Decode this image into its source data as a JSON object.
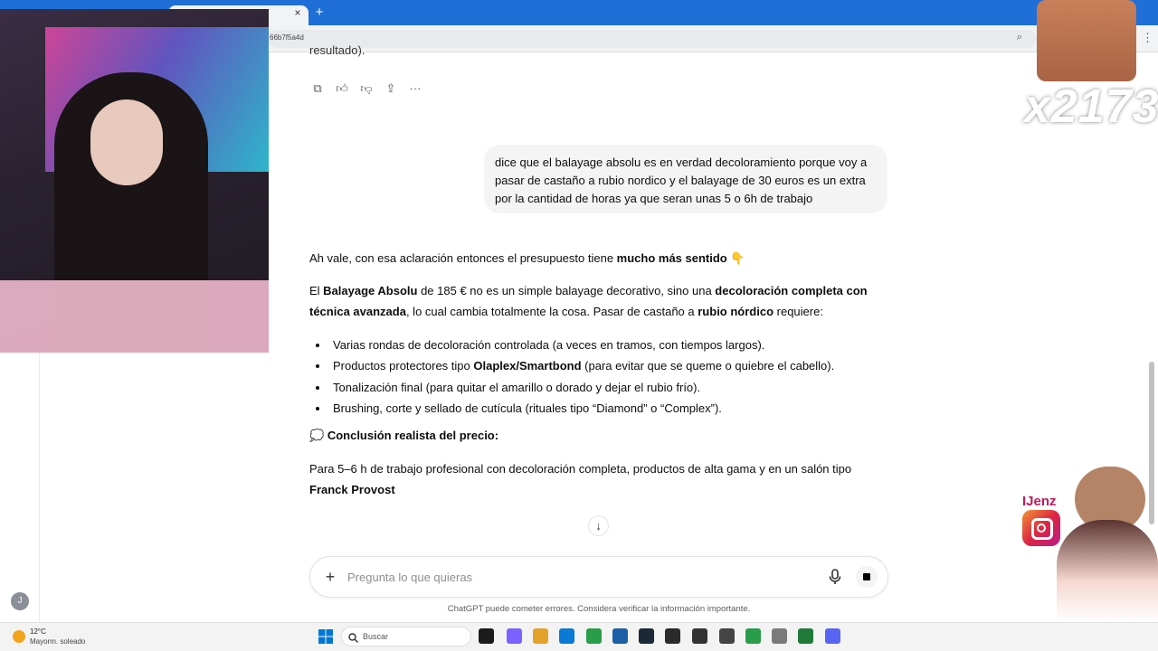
{
  "browser": {
    "url_fragment": "66b7f5a4d"
  },
  "chat": {
    "partial_text": "resultado).",
    "user_message": "dice que el balayage absolu es en verdad decoloramiento porque voy a pasar de castaño a rubio nordico y el balayage de 30 euros es un extra por la cantidad de horas ya que seran unas 5 o 6h de trabajo",
    "p1_text": "Ah vale, con esa aclaración entonces el presupuesto tiene ",
    "p1_bold": "mucho más sentido",
    "p1_emoji": "👇",
    "p2_a": "El ",
    "p2_b": "Balayage Absolu",
    "p2_c": " de 185 € no es un simple balayage decorativo, sino una ",
    "p2_d": "decoloración completa con técnica avanzada",
    "p2_e": ", lo cual cambia totalmente la cosa. Pasar de castaño a ",
    "p2_f": "rubio nórdico",
    "p2_g": " requiere:",
    "bullets": [
      {
        "text": "Varias rondas de decoloración controlada (a veces en tramos, con tiempos largos)."
      },
      {
        "pre": "Productos protectores tipo ",
        "bold": "Olaplex/Smartbond",
        "post": " (para evitar que se queme o quiebre el cabello)."
      },
      {
        "text": "Tonalización final (para quitar el amarillo o dorado y dejar el rubio frío)."
      },
      {
        "text": "Brushing, corte y sellado de cutícula (rituales tipo “Diamond” o “Complex”)."
      }
    ],
    "conclusion_emoji": "💭",
    "conclusion_label": "Conclusión realista del precio:",
    "p3_text": "Para 5–6 h de trabajo profesional con decoloración completa, productos de alta gama y en un salón tipo ",
    "p3_bold": "Franck Provost",
    "composer_placeholder": "Pregunta lo que quieras",
    "disclaimer": "ChatGPT puede cometer errores. Considera verificar la información importante.",
    "user_initial": "J"
  },
  "taskbar": {
    "temperature": "12°C",
    "weather": "Mayorm. soleado",
    "search_label": "Buscar",
    "app_icon_colors": [
      "#1b1b1b",
      "#7b61ff",
      "#e3a32a",
      "#0a7ad6",
      "#2a9d4a",
      "#1b5fa8",
      "#1b2838",
      "#2b2b2b",
      "#333333",
      "#444444",
      "#2a9d4a",
      "#7a7a7a",
      "#1f7a3a",
      "#5865f2"
    ]
  },
  "overlay": {
    "combo_text": "x2173",
    "instagram_handle": "IJenz"
  },
  "colors": {
    "tab_bar": "#1f6fd6",
    "user_bubble": "#f4f4f4",
    "text": "#0d0d0d"
  }
}
